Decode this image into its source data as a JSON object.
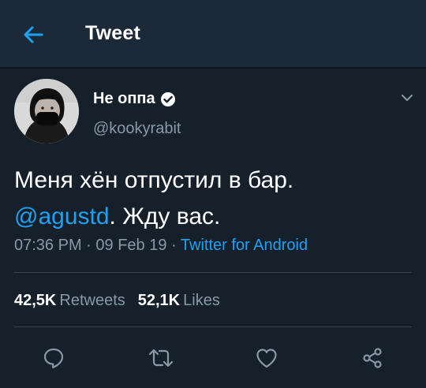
{
  "header": {
    "title": "Tweet",
    "back_icon": "arrow-left-icon"
  },
  "author": {
    "display_name": "Не оппа",
    "username": "@kookyrabit",
    "verified": true,
    "avatar": "avatar-image"
  },
  "tweet": {
    "line1": "Меня хён отпустил в бар.",
    "mention": "@agustd",
    "line2_rest": ". Жду вас."
  },
  "meta": {
    "time": "07:36 PM",
    "sep1": " · ",
    "date": "09 Feb 19",
    "sep2": " · ",
    "source": "Twitter for Android"
  },
  "stats": {
    "retweets_count": "42,5K",
    "retweets_label": "Retweets",
    "likes_count": "52,1K",
    "likes_label": "Likes"
  },
  "actions": [
    "reply-icon",
    "retweet-icon",
    "like-icon",
    "share-icon"
  ],
  "colors": {
    "background": "#15202b",
    "header": "#1c2938",
    "accent": "#1da1f2",
    "secondary_text": "#8899a6",
    "divider": "#38444d"
  }
}
